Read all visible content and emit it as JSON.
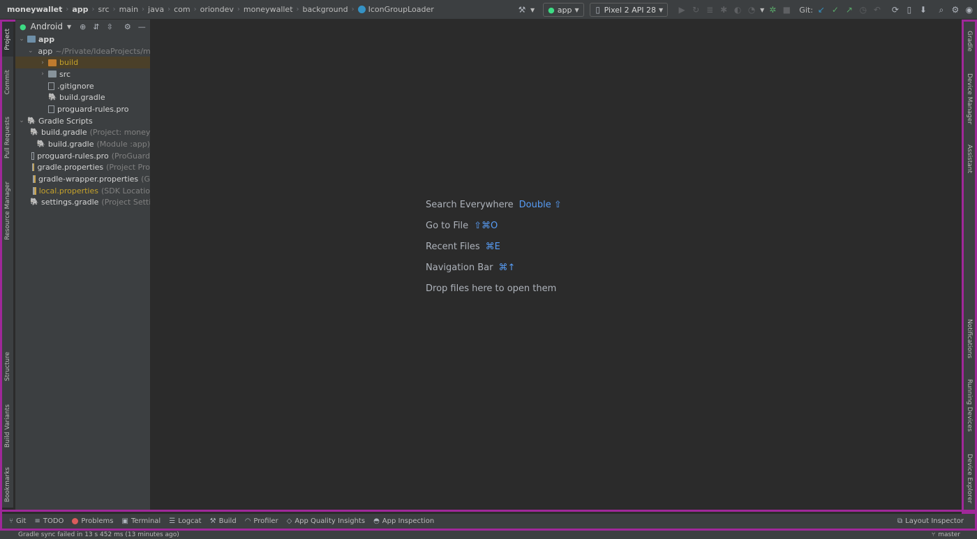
{
  "breadcrumbs": [
    "moneywallet",
    "app",
    "src",
    "main",
    "java",
    "com",
    "oriondev",
    "moneywallet",
    "background",
    "IconGroupLoader"
  ],
  "toolbar": {
    "run_config": "app",
    "device": "Pixel 2 API 28",
    "git_label": "Git:"
  },
  "left_tabs": [
    "Project",
    "Commit",
    "Pull Requests",
    "Resource Manager",
    "Structure",
    "Build Variants",
    "Bookmarks"
  ],
  "right_tabs": [
    "Gradle",
    "Device Manager",
    "Assistant",
    "Notifications",
    "Running Devices",
    "Device Explorer"
  ],
  "project_panel": {
    "view": "Android",
    "tree": [
      {
        "label": "app",
        "hint": "",
        "depth": 0,
        "chevron": "down",
        "icon": "module-folder",
        "bold": true
      },
      {
        "label": "app",
        "hint": "~/Private/IdeaProjects/m",
        "depth": 1,
        "chevron": "down",
        "icon": "module-folder"
      },
      {
        "label": "build",
        "hint": "",
        "depth": 2,
        "chevron": "right",
        "icon": "folder-orange",
        "color": "yellow",
        "selected": true
      },
      {
        "label": "src",
        "hint": "",
        "depth": 2,
        "chevron": "right",
        "icon": "folder"
      },
      {
        "label": ".gitignore",
        "hint": "",
        "depth": 2,
        "chevron": "",
        "icon": "file"
      },
      {
        "label": "build.gradle",
        "hint": "",
        "depth": 2,
        "chevron": "",
        "icon": "gradle"
      },
      {
        "label": "proguard-rules.pro",
        "hint": "",
        "depth": 2,
        "chevron": "",
        "icon": "file"
      },
      {
        "label": "Gradle Scripts",
        "hint": "",
        "depth": 0,
        "chevron": "down",
        "icon": "gradle"
      },
      {
        "label": "build.gradle",
        "hint": "(Project: moneyw",
        "depth": 1,
        "chevron": "",
        "icon": "gradle"
      },
      {
        "label": "build.gradle",
        "hint": "(Module :app)",
        "depth": 1,
        "chevron": "",
        "icon": "gradle"
      },
      {
        "label": "proguard-rules.pro",
        "hint": "(ProGuard",
        "depth": 1,
        "chevron": "",
        "icon": "file"
      },
      {
        "label": "gradle.properties",
        "hint": "(Project Pro",
        "depth": 1,
        "chevron": "",
        "icon": "properties"
      },
      {
        "label": "gradle-wrapper.properties",
        "hint": "(G",
        "depth": 1,
        "chevron": "",
        "icon": "properties"
      },
      {
        "label": "local.properties",
        "hint": "(SDK Locatio",
        "depth": 1,
        "chevron": "",
        "icon": "properties",
        "color": "yellow"
      },
      {
        "label": "settings.gradle",
        "hint": "(Project Settir",
        "depth": 1,
        "chevron": "",
        "icon": "gradle"
      }
    ]
  },
  "editor_hints": [
    {
      "label": "Search Everywhere",
      "shortcut": "Double ⇧"
    },
    {
      "label": "Go to File",
      "shortcut": "⇧⌘O"
    },
    {
      "label": "Recent Files",
      "shortcut": "⌘E"
    },
    {
      "label": "Navigation Bar",
      "shortcut": "⌘↑"
    },
    {
      "label": "Drop files here to open them",
      "shortcut": ""
    }
  ],
  "bottom_tabs": [
    "Git",
    "TODO",
    "Problems",
    "Terminal",
    "Logcat",
    "Build",
    "Profiler",
    "App Quality Insights",
    "App Inspection"
  ],
  "bottom_right_tab": "Layout Inspector",
  "status": {
    "message": "Gradle sync failed in 13 s 452 ms (13 minutes ago)",
    "branch": "master"
  },
  "colors": {
    "frame_highlight": "#a0289a",
    "accent_blue": "#589df6",
    "android_green": "#3ddc84",
    "modified_yellow": "#c5a22b"
  }
}
